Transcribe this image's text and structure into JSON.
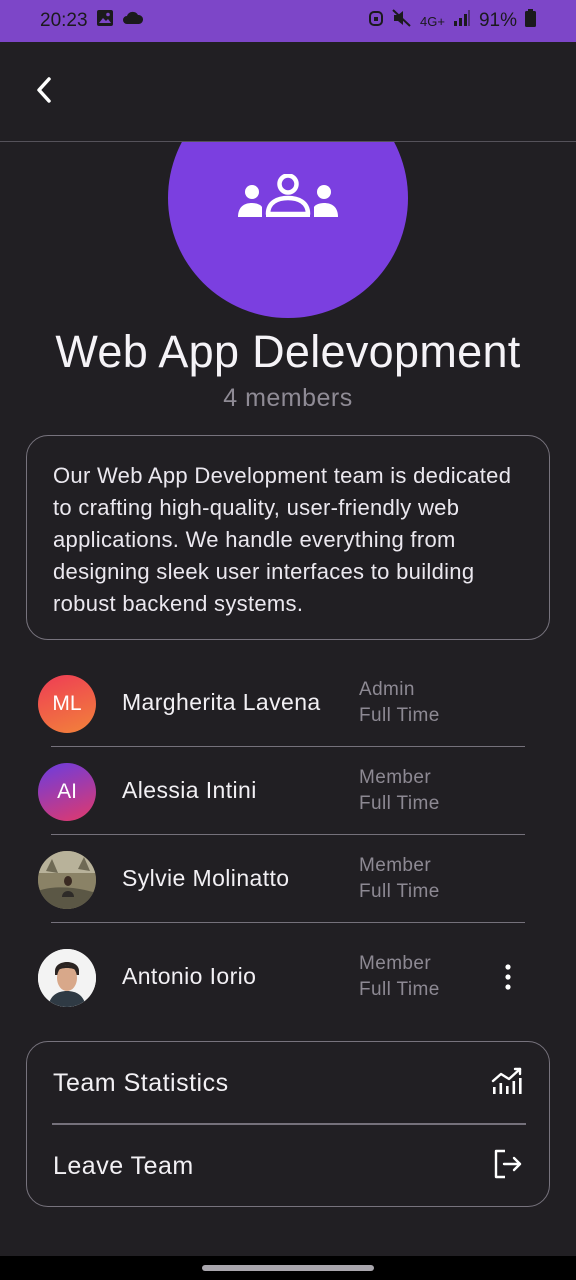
{
  "status_bar": {
    "time": "20:23",
    "network": "4G+",
    "battery": "91%",
    "left_icons": [
      "image-icon",
      "cloud-icon"
    ],
    "right_icons": [
      "alarm-icon",
      "mute-icon",
      "data-arrows-icon",
      "signal-icon",
      "battery-icon"
    ]
  },
  "colors": {
    "accent": "#7b3fe0",
    "status_bar": "#7d46c8",
    "background": "#211f23"
  },
  "team": {
    "icon": "group-icon",
    "title": "Web App Delevopment",
    "members_count": "4 members",
    "description": "Our Web App Development team is dedicated to crafting high-quality, user-friendly web applications. We handle everything from designing sleek user interfaces to building robust backend systems."
  },
  "members": [
    {
      "initials": "ML",
      "name": "Margherita Lavena",
      "role": "Admin",
      "type": "Full Time",
      "avatar_color": "#ee5a3a"
    },
    {
      "initials": "AI",
      "name": "Alessia Intini",
      "role": "Member",
      "type": "Full Time",
      "avatar_color": "#a13ad8"
    },
    {
      "initials": "",
      "name": "Sylvie Molinatto",
      "role": "Member",
      "type": "Full Time",
      "avatar_color": "#6b6a5b"
    },
    {
      "initials": "",
      "name": "Antonio Iorio",
      "role": "Member",
      "type": "Full Time",
      "avatar_color": "#f1f1f1"
    }
  ],
  "actions": {
    "statistics_label": "Team Statistics",
    "statistics_icon": "chart-icon",
    "leave_label": "Leave Team",
    "leave_icon": "logout-icon"
  }
}
